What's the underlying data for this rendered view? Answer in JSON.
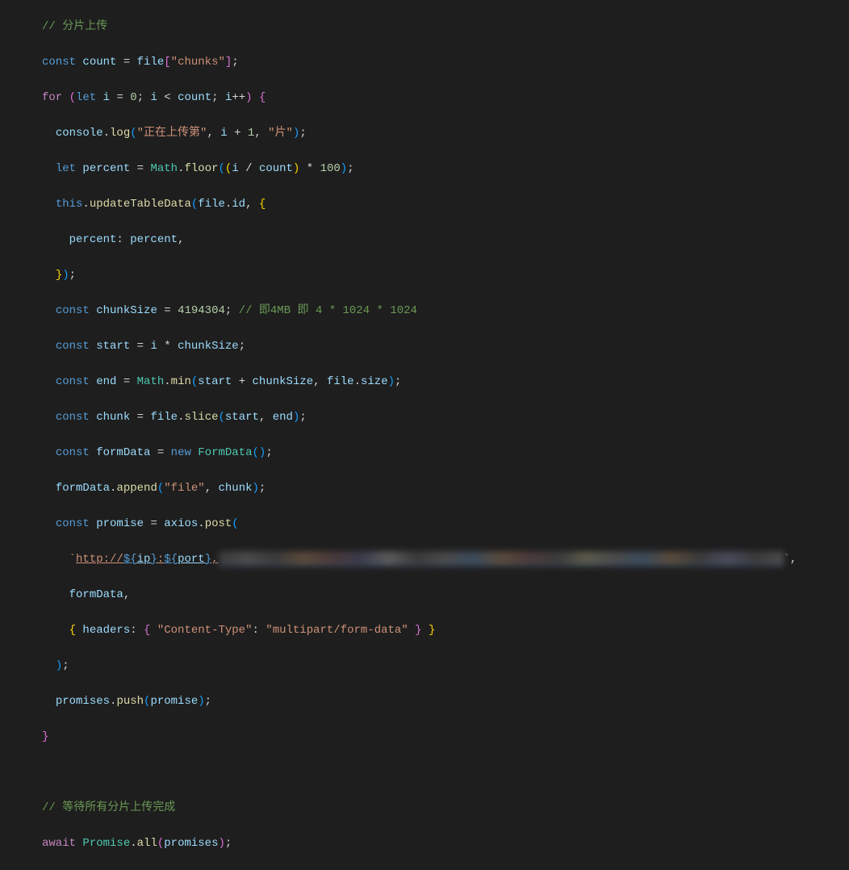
{
  "code": {
    "line1_comment": "// 分片上传",
    "line2": {
      "const": "const",
      "count": "count",
      "eq": " = ",
      "file": "file",
      "bracket_open": "[",
      "chunks_str": "\"chunks\"",
      "bracket_close": "]",
      "semi": ";"
    },
    "line3": {
      "for": "for",
      "paren_open": " (",
      "let": "let",
      "i": " i",
      "eq": " = ",
      "zero": "0",
      "semi1": "; ",
      "i2": "i",
      "lt": " < ",
      "count": "count",
      "semi2": "; ",
      "i3": "i",
      "inc": "++",
      "paren_close": ") ",
      "brace": "{"
    },
    "line4": {
      "console": "console",
      "dot": ".",
      "log": "log",
      "paren_open": "(",
      "str1": "\"正在上传第\"",
      "comma1": ", ",
      "i": "i",
      "plus": " + ",
      "one": "1",
      "comma2": ", ",
      "str2": "\"片\"",
      "paren_close": ")",
      "semi": ";"
    },
    "line5": {
      "let": "let",
      "percent": " percent",
      "eq": " = ",
      "math": "Math",
      "dot": ".",
      "floor": "floor",
      "paren_open": "(",
      "paren_open2": "(",
      "i": "i",
      "div": " / ",
      "count": "count",
      "paren_close2": ")",
      "mul": " * ",
      "hundred": "100",
      "paren_close": ")",
      "semi": ";"
    },
    "line6": {
      "this": "this",
      "dot": ".",
      "updateTableData": "updateTableData",
      "paren_open": "(",
      "file": "file",
      "dot2": ".",
      "id": "id",
      "comma": ", ",
      "brace": "{"
    },
    "line7": {
      "percent_key": "percent",
      "colon": ":",
      "percent_val": " percent",
      "comma": ","
    },
    "line8": {
      "brace": "}",
      "paren": ")",
      "semi": ";"
    },
    "line9": {
      "const": "const",
      "chunkSize": " chunkSize",
      "eq": " = ",
      "num": "4194304",
      "semi": "; ",
      "comment": "// 即4MB 即 4 * 1024 * 1024"
    },
    "line10": {
      "const": "const",
      "start": " start",
      "eq": " = ",
      "i": "i",
      "mul": " * ",
      "chunkSize": "chunkSize",
      "semi": ";"
    },
    "line11": {
      "const": "const",
      "end": " end",
      "eq": " = ",
      "math": "Math",
      "dot": ".",
      "min": "min",
      "paren_open": "(",
      "start": "start",
      "plus": " + ",
      "chunkSize": "chunkSize",
      "comma": ", ",
      "file": "file",
      "dot2": ".",
      "size": "size",
      "paren_close": ")",
      "semi": ";"
    },
    "line12": {
      "const": "const",
      "chunk": " chunk",
      "eq": " = ",
      "file": "file",
      "dot": ".",
      "slice": "slice",
      "paren_open": "(",
      "start": "start",
      "comma": ", ",
      "end": "end",
      "paren_close": ")",
      "semi": ";"
    },
    "line13": {
      "const": "const",
      "formData": " formData",
      "eq": " = ",
      "new": "new",
      "FormData": " FormData",
      "paren_open": "(",
      "paren_close": ")",
      "semi": ";"
    },
    "line14": {
      "formData": "formData",
      "dot": ".",
      "append": "append",
      "paren_open": "(",
      "str": "\"file\"",
      "comma": ", ",
      "chunk": "chunk",
      "paren_close": ")",
      "semi": ";"
    },
    "line15": {
      "const": "const",
      "promise": " promise",
      "eq": " = ",
      "axios": "axios",
      "dot": ".",
      "post": "post",
      "paren_open": "("
    },
    "line16": {
      "backtick": "`",
      "http": "http://",
      "dollar1": "${",
      "ip": "ip",
      "close1": "}",
      "colon": ":",
      "dollar2": "${",
      "port": "port",
      "close2": "}",
      "comma_str": ",",
      "backtick_end": "`",
      "comma_end": ","
    },
    "line17": {
      "formData": "formData",
      "comma": ","
    },
    "line18": {
      "brace_open": "{",
      "headers": " headers",
      "colon": ":",
      "brace_open2": " {",
      "key": " \"Content-Type\"",
      "colon2": ":",
      "val": " \"multipart/form-data\"",
      "brace_close2": " }",
      "brace_close": " }"
    },
    "line19": {
      "paren": ")",
      "semi": ";"
    },
    "line20": {
      "promises": "promises",
      "dot": ".",
      "push": "push",
      "paren_open": "(",
      "promise": "promise",
      "paren_close": ")",
      "semi": ";"
    },
    "line21": {
      "brace": "}"
    },
    "line23_comment": "// 等待所有分片上传完成",
    "line24": {
      "await": "await",
      "Promise": " Promise",
      "dot": ".",
      "all": "all",
      "paren_open": "(",
      "promises": "promises",
      "paren_close": ")",
      "semi": ";"
    }
  }
}
